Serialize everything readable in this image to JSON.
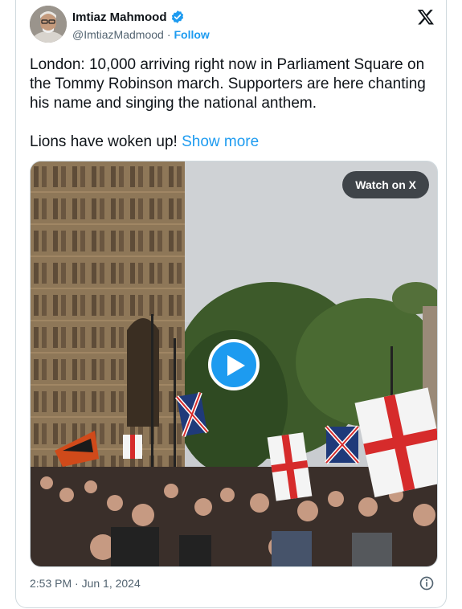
{
  "author": {
    "name": "Imtiaz Mahmood",
    "handle": "@ImtiazMadmood",
    "separator": "·",
    "follow_label": "Follow",
    "verified_color": "#1d9bf0"
  },
  "tweet": {
    "paragraph1": "London: 10,000 arriving right now in Parliament Square on the Tommy Robinson march. Supporters are here chanting his name and singing the national anthem.",
    "paragraph2": "Lions have woken up! ",
    "show_more_label": "Show more"
  },
  "media": {
    "watch_label": "Watch on X",
    "play_icon": "play-icon"
  },
  "footer": {
    "timestamp": "2:53 PM · Jun 1, 2024",
    "info_icon": "info-icon"
  },
  "colors": {
    "accent": "#1d9bf0",
    "text": "#0f1419",
    "muted": "#536471",
    "border": "#cfd9de"
  }
}
